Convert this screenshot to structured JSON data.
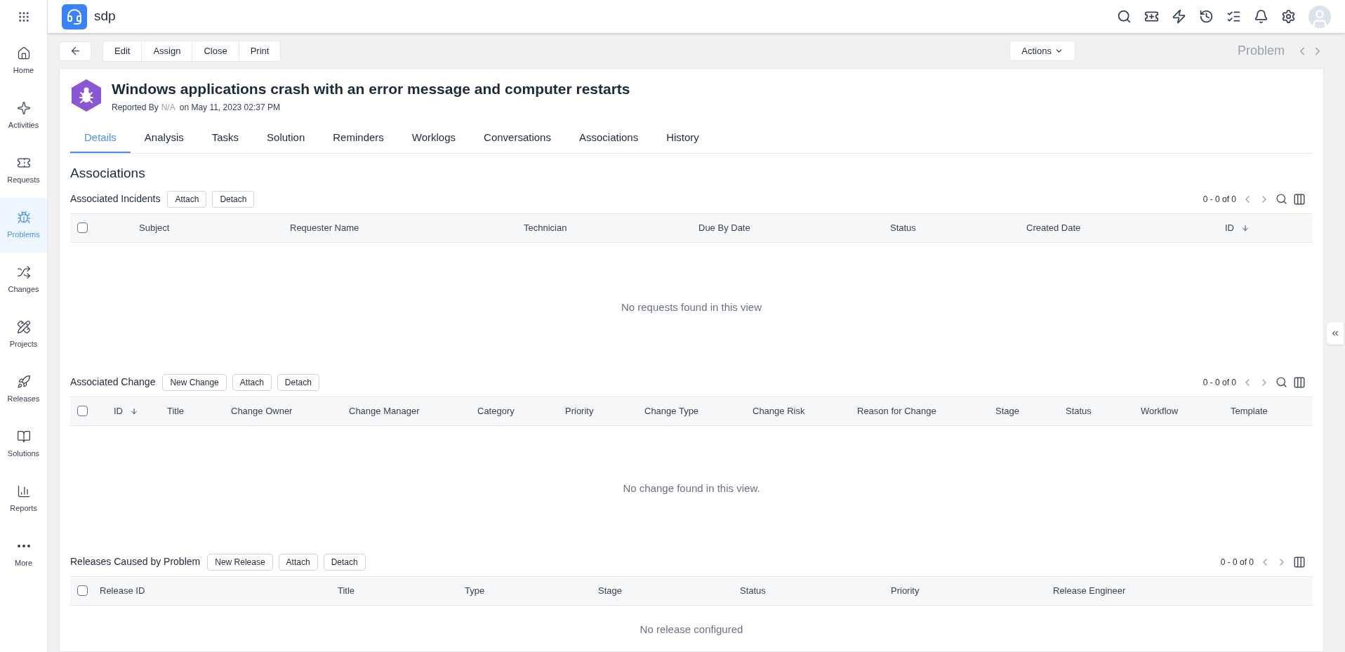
{
  "app": {
    "name": "sdp"
  },
  "sidebar": {
    "items": [
      {
        "label": "Home",
        "selected": false
      },
      {
        "label": "Activities",
        "selected": false
      },
      {
        "label": "Requests",
        "selected": false
      },
      {
        "label": "Problems",
        "selected": true
      },
      {
        "label": "Changes",
        "selected": false
      },
      {
        "label": "Projects",
        "selected": false
      },
      {
        "label": "Releases",
        "selected": false
      },
      {
        "label": "Solutions",
        "selected": false
      },
      {
        "label": "Reports",
        "selected": false
      },
      {
        "label": "More",
        "selected": false
      }
    ]
  },
  "toolbar": {
    "buttons": [
      "Edit",
      "Assign",
      "Close",
      "Print"
    ],
    "actions": "Actions",
    "module": "Problem"
  },
  "problem": {
    "title": "Windows applications crash with an error message and computer restarts",
    "reported_by_label": "Reported By",
    "reporter": "N/A",
    "reported_on": "on May 11, 2023 02:37 PM"
  },
  "tabs": [
    {
      "label": "Details",
      "selected": true
    },
    {
      "label": "Analysis",
      "selected": false
    },
    {
      "label": "Tasks",
      "selected": false
    },
    {
      "label": "Solution",
      "selected": false
    },
    {
      "label": "Reminders",
      "selected": false
    },
    {
      "label": "Worklogs",
      "selected": false
    },
    {
      "label": "Conversations",
      "selected": false
    },
    {
      "label": "Associations",
      "selected": false
    },
    {
      "label": "History",
      "selected": false
    }
  ],
  "section_title": "Associations",
  "tables": [
    {
      "title": "Associated Incidents",
      "buttons": [
        "Attach",
        "Detach"
      ],
      "pager": "0 - 0 of 0",
      "search": true,
      "select_all_checked": false,
      "columns": [
        {
          "label": "Subject"
        },
        {
          "label": "Requester Name"
        },
        {
          "label": "Technician"
        },
        {
          "label": "Due By Date"
        },
        {
          "label": "Status"
        },
        {
          "label": "Created Date"
        },
        {
          "label": "ID",
          "sorted": true
        }
      ],
      "empty": "No requests found in this view"
    },
    {
      "title": "Associated Change",
      "buttons": [
        "New Change",
        "Attach",
        "Detach"
      ],
      "pager": "0 - 0 of 0",
      "search": true,
      "select_all_checked": false,
      "columns": [
        {
          "label": "ID",
          "sorted": true
        },
        {
          "label": "Title"
        },
        {
          "label": "Change Owner"
        },
        {
          "label": "Change Manager"
        },
        {
          "label": "Category"
        },
        {
          "label": "Priority"
        },
        {
          "label": "Change Type"
        },
        {
          "label": "Change Risk"
        },
        {
          "label": "Reason for Change"
        },
        {
          "label": "Stage"
        },
        {
          "label": "Status"
        },
        {
          "label": "Workflow"
        },
        {
          "label": "Template"
        }
      ],
      "empty": "No change found in this view."
    },
    {
      "title": "Releases Caused by Problem",
      "buttons": [
        "New Release",
        "Attach",
        "Detach"
      ],
      "pager": "0 - 0 of 0",
      "search": false,
      "select_all_checked": false,
      "columns": [
        {
          "label": "Release ID"
        },
        {
          "label": "Title"
        },
        {
          "label": "Type"
        },
        {
          "label": "Stage"
        },
        {
          "label": "Status"
        },
        {
          "label": "Priority"
        },
        {
          "label": "Release Engineer"
        }
      ],
      "empty": "No release configured"
    }
  ]
}
